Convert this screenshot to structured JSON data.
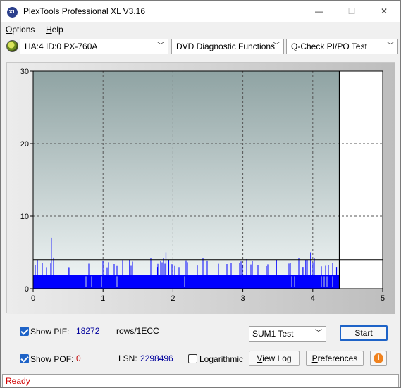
{
  "window": {
    "title": "PlexTools Professional XL V3.16",
    "app_icon_text": "XL",
    "min_symbol": "—",
    "max_symbol": "☐",
    "close_symbol": "✕"
  },
  "menu": {
    "options": {
      "ul": "O",
      "rest": "ptions"
    },
    "help": {
      "ul": "H",
      "rest": "elp"
    }
  },
  "toolbar": {
    "drive": "HA:4 ID:0  PX-760A",
    "function": "DVD Diagnostic Functions",
    "test": "Q-Check PI/PO Test",
    "arrow": "﹀"
  },
  "chart_data": {
    "type": "bar",
    "xlim": [
      0,
      5
    ],
    "ylim": [
      0,
      30
    ],
    "x_ticks": [
      "0",
      "1",
      "2",
      "3",
      "4",
      "5"
    ],
    "y_ticks": [
      "0",
      "10",
      "20",
      "30"
    ],
    "grid": true,
    "end_marker_x": 4.38,
    "threshold_y": 4,
    "series": [
      {
        "color": "#0000ff",
        "baseline": 1.9,
        "spikes": [
          {
            "x": 0.26,
            "y": 7
          },
          {
            "x": 0.06,
            "y": 4
          },
          {
            "x": 0.5,
            "y": 3
          },
          {
            "x": 1.38,
            "y": 4
          },
          {
            "x": 1.78,
            "y": 3
          },
          {
            "x": 1.9,
            "y": 5
          },
          {
            "x": 1.94,
            "y": 4
          },
          {
            "x": 3.48,
            "y": 4
          },
          {
            "x": 3.86,
            "y": 3
          },
          {
            "x": 3.9,
            "y": 4
          },
          {
            "x": 3.97,
            "y": 5
          },
          {
            "x": 4.34,
            "y": 3
          }
        ]
      }
    ]
  },
  "controls": {
    "show_pif_label": "Show PIF:",
    "pif_value": "18272",
    "pif_unit": "rows/1ECC",
    "show_pof_label_a": "Show PO",
    "show_pof_label_u": "F",
    "show_pof_label_b": ":",
    "pof_value": "0",
    "lsn_label": "LSN:",
    "lsn_value": "2298496",
    "logarithmic_label": "Logarithmic",
    "test_select": "SUM1 Test",
    "start_ul": "S",
    "start_rest": "tart",
    "viewlog_ul": "V",
    "viewlog_rest": "iew Log",
    "prefs_ul": "P",
    "prefs_rest": "references",
    "info_glyph": "i"
  },
  "status": {
    "text": "Ready"
  }
}
